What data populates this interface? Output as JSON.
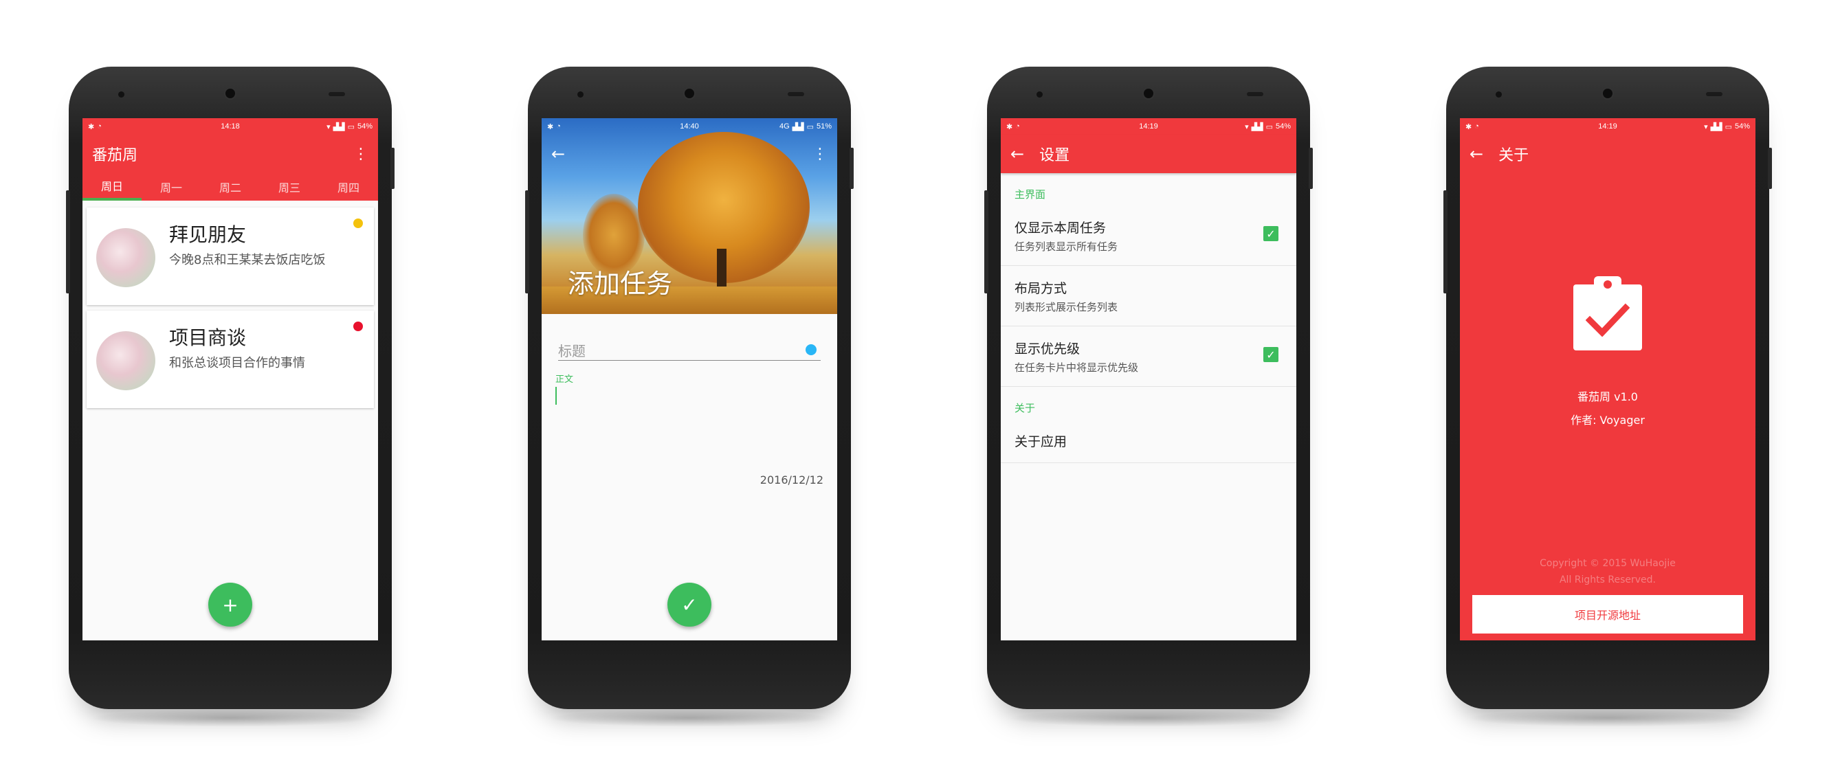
{
  "colors": {
    "primary": "#f0393d",
    "accent": "#3dbd5d",
    "yellow": "#f4c20d",
    "red_dot": "#e8112d",
    "blue_dot": "#29b6f6"
  },
  "phone1": {
    "status": {
      "time": "14:18",
      "battery": "54%"
    },
    "app_title": "番茄周",
    "tabs": [
      "周日",
      "周一",
      "周二",
      "周三",
      "周四"
    ],
    "cards": [
      {
        "title": "拜见朋友",
        "body": "今晚8点和王某某去饭店吃饭",
        "priority_color": "#f4c20d"
      },
      {
        "title": "项目商谈",
        "body": "和张总谈项目合作的事情",
        "priority_color": "#e8112d"
      }
    ],
    "fab_icon": "+"
  },
  "phone2": {
    "status": {
      "time": "14:40",
      "network": "4G",
      "battery": "51%"
    },
    "header_title": "添加任务",
    "title_placeholder": "标题",
    "body_label": "正文",
    "date": "2016/12/12"
  },
  "phone3": {
    "status": {
      "time": "14:19",
      "battery": "54%"
    },
    "title": "设置",
    "sections": [
      {
        "header": "主界面",
        "items": [
          {
            "title": "仅显示本周任务",
            "subtitle": "任务列表显示所有任务",
            "checked": true
          },
          {
            "title": "布局方式",
            "subtitle": "列表形式展示任务列表",
            "checked": false
          },
          {
            "title": "显示优先级",
            "subtitle": "在任务卡片中将显示优先级",
            "checked": true
          }
        ]
      },
      {
        "header": "关于",
        "items": [
          {
            "title": "关于应用",
            "subtitle": "",
            "checked": false
          }
        ]
      }
    ]
  },
  "phone4": {
    "status": {
      "time": "14:19",
      "battery": "54%"
    },
    "title": "关于",
    "app_name": "番茄周  v1.0",
    "author": "作者: Voyager",
    "copyright_line1": "Copyright © 2015 WuHaojie",
    "copyright_line2": "All Rights Reserved.",
    "button_label": "项目开源地址"
  }
}
